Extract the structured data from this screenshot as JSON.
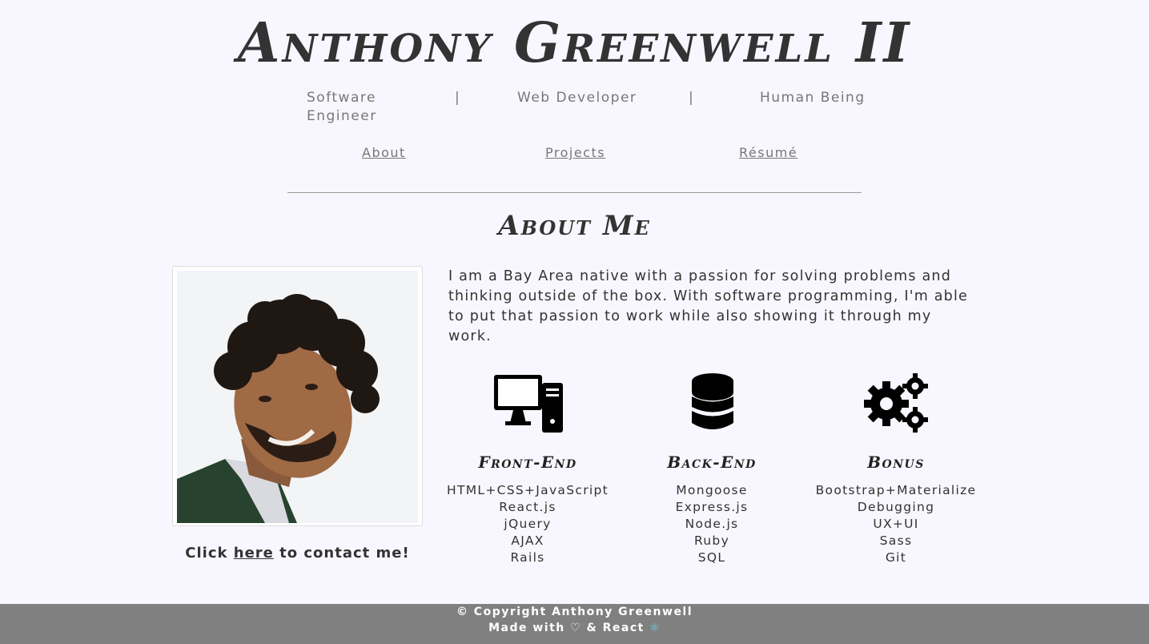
{
  "header": {
    "title": "Anthony Greenwell II",
    "taglines": [
      "Software Engineer",
      "Web Developer",
      "Human Being"
    ],
    "separator": "|"
  },
  "nav": {
    "about": "About",
    "projects": "Projects",
    "resume": "Résumé"
  },
  "about": {
    "heading": "About Me",
    "bio": "I am a Bay Area native with a passion for solving problems and thinking outside of the box. With software programming, I'm able to put that passion to work while also showing it through my work.",
    "contact_prefix": "Click ",
    "contact_link": "here",
    "contact_suffix": " to contact me!"
  },
  "skills": [
    {
      "title": "Front-End",
      "icon": "desktop-computer-icon",
      "items": [
        "HTML+CSS+JavaScript",
        "React.js",
        "jQuery",
        "AJAX",
        "Rails"
      ]
    },
    {
      "title": "Back-End",
      "icon": "database-icon",
      "items": [
        "Mongoose",
        "Express.js",
        "Node.js",
        "Ruby",
        "SQL"
      ]
    },
    {
      "title": "Bonus",
      "icon": "gears-icon",
      "items": [
        "Bootstrap+Materialize",
        "Debugging",
        "UX+UI",
        "Sass",
        "Git"
      ]
    }
  ],
  "footer": {
    "copyright": "© Copyright Anthony Greenwell",
    "made_with": "Made with ♡ & React",
    "react_icon": "⚛"
  },
  "colors": {
    "background": "#f8f7ff",
    "footer": "#808080",
    "text": "#333333",
    "muted": "#777777"
  }
}
